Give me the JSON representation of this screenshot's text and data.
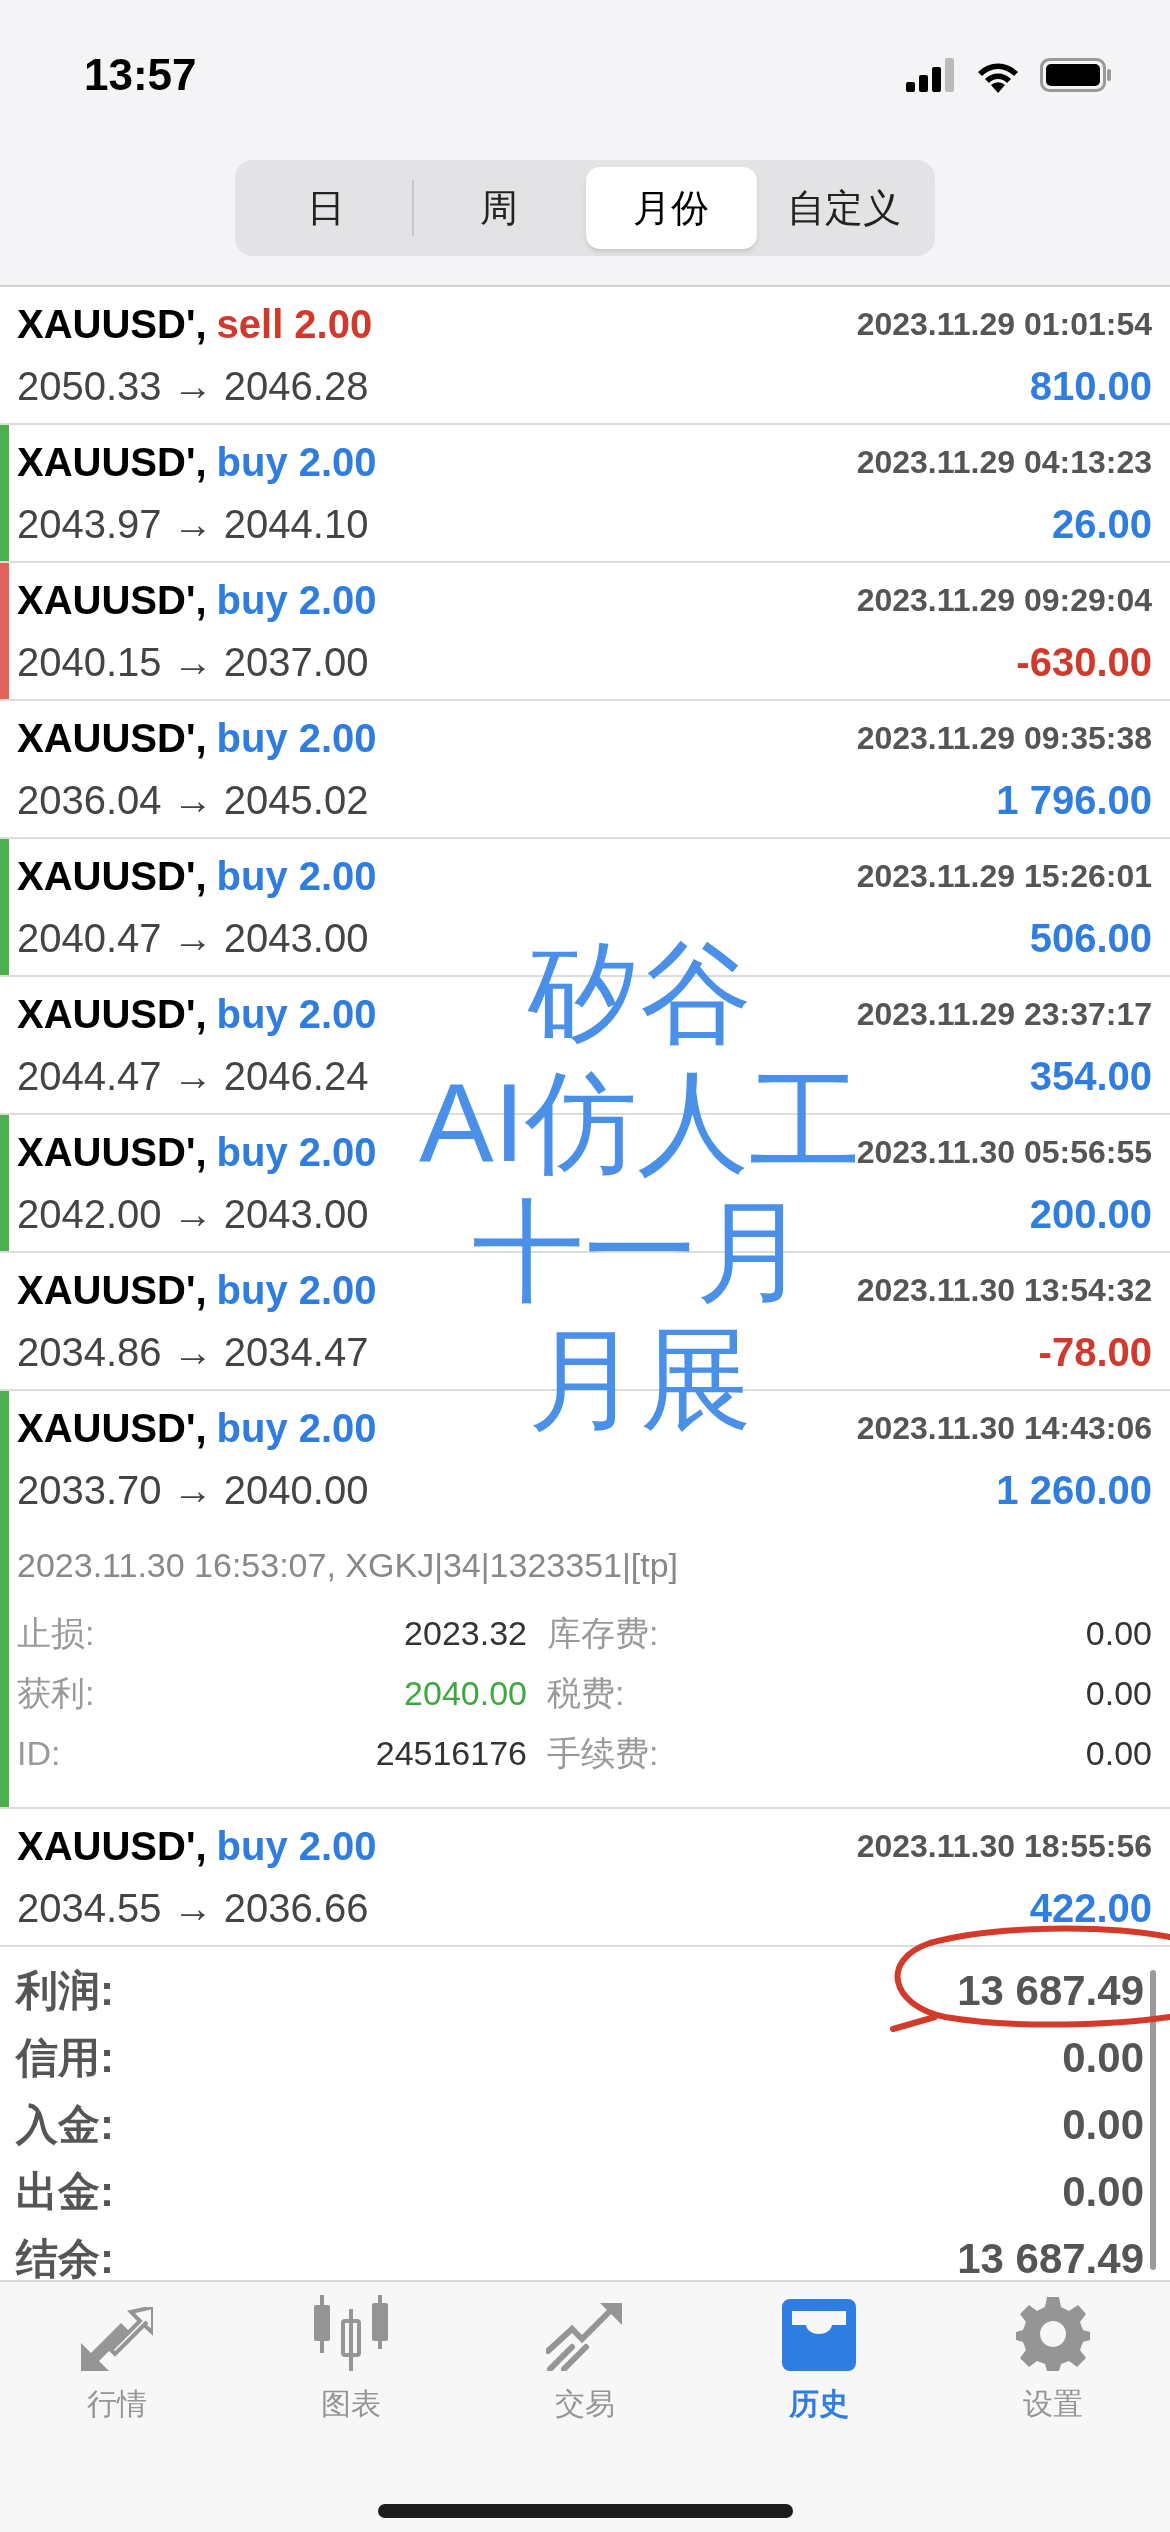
{
  "status_bar": {
    "time": "13:57"
  },
  "period_tabs": [
    {
      "label": "日",
      "selected": false
    },
    {
      "label": "周",
      "selected": false
    },
    {
      "label": "月份",
      "selected": true
    },
    {
      "label": "自定义",
      "selected": false
    }
  ],
  "deals": [
    {
      "symbol": "XAUUSD',",
      "kind": "sell",
      "action": "sell 2.00",
      "time": "2023.11.29 01:01:54",
      "prices": "2050.33 → 2046.28",
      "profit": "810.00",
      "loss": false
    },
    {
      "symbol": "XAUUSD',",
      "kind": "buy",
      "action": "buy 2.00",
      "time": "2023.11.29 04:13:23",
      "prices": "2043.97 → 2044.10",
      "profit": "26.00",
      "loss": false,
      "color": "#4caf50"
    },
    {
      "symbol": "XAUUSD',",
      "kind": "buy",
      "action": "buy 2.00",
      "time": "2023.11.29 09:29:04",
      "prices": "2040.15 → 2037.00",
      "profit": "-630.00",
      "loss": true,
      "color": "#e0645a"
    },
    {
      "symbol": "XAUUSD',",
      "kind": "buy",
      "action": "buy 2.00",
      "time": "2023.11.29 09:35:38",
      "prices": "2036.04 → 2045.02",
      "profit": "1 796.00",
      "loss": false
    },
    {
      "symbol": "XAUUSD',",
      "kind": "buy",
      "action": "buy 2.00",
      "time": "2023.11.29 15:26:01",
      "prices": "2040.47 → 2043.00",
      "profit": "506.00",
      "loss": false,
      "color": "#4caf50"
    },
    {
      "symbol": "XAUUSD',",
      "kind": "buy",
      "action": "buy 2.00",
      "time": "2023.11.29 23:37:17",
      "prices": "2044.47 → 2046.24",
      "profit": "354.00",
      "loss": false
    },
    {
      "symbol": "XAUUSD',",
      "kind": "buy",
      "action": "buy 2.00",
      "time": "2023.11.30 05:56:55",
      "prices": "2042.00 → 2043.00",
      "profit": "200.00",
      "loss": false,
      "color": "#4caf50"
    },
    {
      "symbol": "XAUUSD',",
      "kind": "buy",
      "action": "buy 2.00",
      "time": "2023.11.30 13:54:32",
      "prices": "2034.86 → 2034.47",
      "profit": "-78.00",
      "loss": true
    },
    {
      "symbol": "XAUUSD',",
      "kind": "buy",
      "action": "buy 2.00",
      "time": "2023.11.30 14:43:06",
      "prices": "2033.70 → 2040.00",
      "profit": "1 260.00",
      "loss": false,
      "color": "#4caf50",
      "expanded": true,
      "details": {
        "info": "2023.11.30 16:53:07, XGKJ|34|1323351|[tp]",
        "fields": [
          {
            "label": "止损:",
            "value": "2023.32",
            "kind": "plain"
          },
          {
            "label": "库存费:",
            "value": "0.00",
            "kind": "plain"
          },
          {
            "label": "获利:",
            "value": "2040.00",
            "kind": "tp"
          },
          {
            "label": "税费:",
            "value": "0.00",
            "kind": "plain"
          },
          {
            "label": "ID:",
            "value": "24516176",
            "kind": "plain"
          },
          {
            "label": "手续费:",
            "value": "0.00",
            "kind": "plain"
          }
        ]
      }
    },
    {
      "symbol": "XAUUSD',",
      "kind": "buy",
      "action": "buy 2.00",
      "time": "2023.11.30 18:55:56",
      "prices": "2034.55 → 2036.66",
      "profit": "422.00",
      "loss": false
    }
  ],
  "totals": [
    {
      "label": "利润:",
      "value": "13 687.49"
    },
    {
      "label": "信用:",
      "value": "0.00"
    },
    {
      "label": "入金:",
      "value": "0.00"
    },
    {
      "label": "出金:",
      "value": "0.00"
    },
    {
      "label": "结余:",
      "value": "13 687.49"
    }
  ],
  "annotation": {
    "lines": [
      "矽谷",
      "AI仿人工",
      "十一月",
      "月展"
    ]
  },
  "bottom_tabs": [
    {
      "label": "行情",
      "kind": "quotes",
      "selected": false
    },
    {
      "label": "图表",
      "kind": "chart",
      "selected": false
    },
    {
      "label": "交易",
      "kind": "trade",
      "selected": false
    },
    {
      "label": "历史",
      "kind": "history",
      "selected": true
    },
    {
      "label": "设置",
      "kind": "settings",
      "selected": false
    }
  ]
}
